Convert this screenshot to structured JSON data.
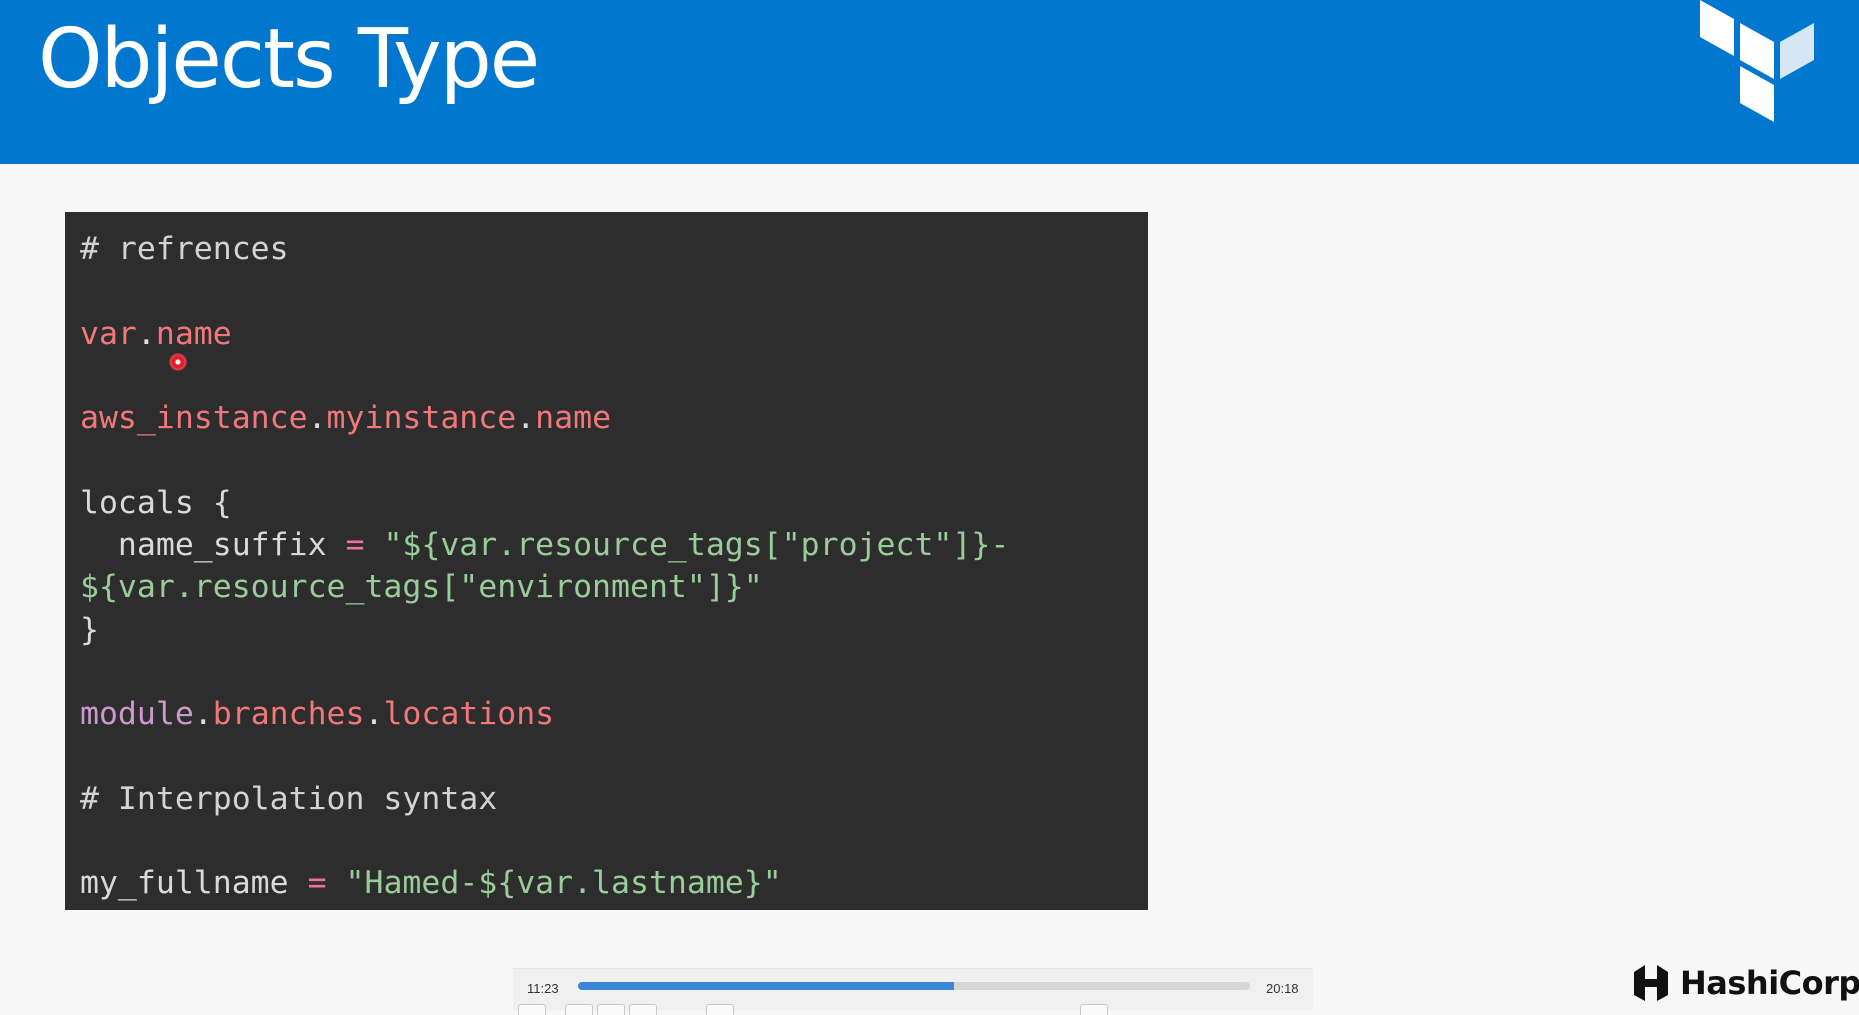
{
  "header": {
    "title": "Objects Type",
    "logo_icon": "terraform-logo-icon",
    "background": "#0277d0"
  },
  "code": {
    "lines": [
      [
        {
          "t": "# refrences",
          "c": "comment"
        }
      ],
      [],
      [
        {
          "t": "var",
          "c": "var"
        },
        {
          "t": ".",
          "c": "punct"
        },
        {
          "t": "name",
          "c": "var"
        }
      ],
      [],
      [
        {
          "t": "aws_instance",
          "c": "var"
        },
        {
          "t": ".",
          "c": "punct"
        },
        {
          "t": "myinstance",
          "c": "var"
        },
        {
          "t": ".",
          "c": "punct"
        },
        {
          "t": "name",
          "c": "var"
        }
      ],
      [],
      [
        {
          "t": "locals {",
          "c": "default"
        }
      ],
      [
        {
          "t": "  name_suffix ",
          "c": "default"
        },
        {
          "t": "=",
          "c": "op"
        },
        {
          "t": " \"${var.resource_tags[\"project\"]}-",
          "c": "str"
        }
      ],
      [
        {
          "t": "${var.resource_tags[\"environment\"]}\"",
          "c": "str"
        }
      ],
      [
        {
          "t": "}",
          "c": "default"
        }
      ],
      [],
      [
        {
          "t": "module",
          "c": "module"
        },
        {
          "t": ".",
          "c": "punct"
        },
        {
          "t": "branches",
          "c": "var"
        },
        {
          "t": ".",
          "c": "punct"
        },
        {
          "t": "locations",
          "c": "var"
        }
      ],
      [],
      [
        {
          "t": "# Interpolation syntax",
          "c": "comment"
        }
      ],
      [],
      [
        {
          "t": "my_fullname ",
          "c": "default"
        },
        {
          "t": "=",
          "c": "op"
        },
        {
          "t": " \"Hamed-${var.lastname}\"",
          "c": "str"
        }
      ]
    ]
  },
  "player": {
    "current_time": "11:23",
    "total_time": "20:18",
    "progress": 0.56
  },
  "brand": {
    "name": "HashiCorp",
    "icon": "hashicorp-logo-icon"
  }
}
